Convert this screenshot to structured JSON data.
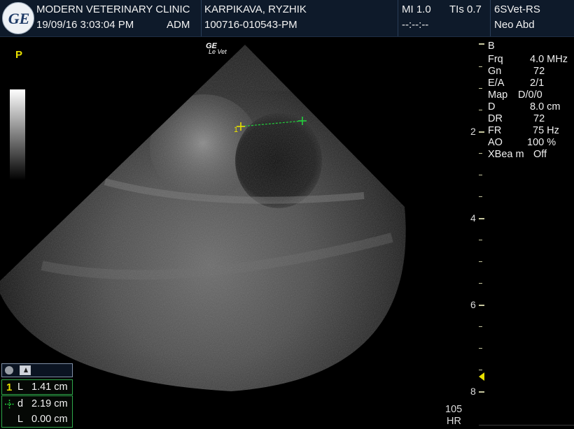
{
  "header": {
    "clinic": "MODERN VETERINARY CLINIC",
    "datetime": "19/09/16 3:03:04 PM",
    "operator": "ADM",
    "patient_name": "KARPIKAVA, RYZHIK",
    "patient_id": "100716-010543-PM",
    "mi": "MI 1.0",
    "tis": "TIs 0.7",
    "timer": "--:--:--",
    "probe": "6SVet-RS",
    "preset": "Neo Abd"
  },
  "logo": {
    "text": "GE",
    "icon": "ge-logo-icon"
  },
  "image": {
    "watermark_main": "GE",
    "watermark_sub": "Le Vet",
    "orientation_marker": "P",
    "cursor_label": "1"
  },
  "parameters": [
    {
      "label": "B",
      "value": ""
    },
    {
      "label": "Frq",
      "value": "4.0 MHz"
    },
    {
      "label": "Gn",
      "value": "72"
    },
    {
      "label": "E/A",
      "value": "2/1"
    },
    {
      "label": "Map",
      "value": "D/0/0"
    },
    {
      "label": "D",
      "value": "8.0 cm"
    },
    {
      "label": "DR",
      "value": "72"
    },
    {
      "label": "FR",
      "value": "75 Hz"
    },
    {
      "label": "AO",
      "value": "100 %"
    },
    {
      "label": "XBea m",
      "value": "Off"
    }
  ],
  "depth_scale": [
    "2",
    "4",
    "6",
    "8"
  ],
  "heart_rate": {
    "value": "105",
    "label": "HR"
  },
  "measurements": {
    "toolbar_icons": [
      "record-icon",
      "cursor-tool-icon"
    ],
    "m1_index": "1",
    "m1_label": "L",
    "m1_value": "1.41 cm",
    "m2_label": "d",
    "m2_value": "2.19 cm",
    "m3_label": "L",
    "m3_value": "0.00 cm"
  },
  "colors": {
    "header_bg": "#0e1a2a",
    "marker_yellow": "#e8e000",
    "caliper_green": "#22d03c",
    "box_border": "#2fa84a"
  }
}
